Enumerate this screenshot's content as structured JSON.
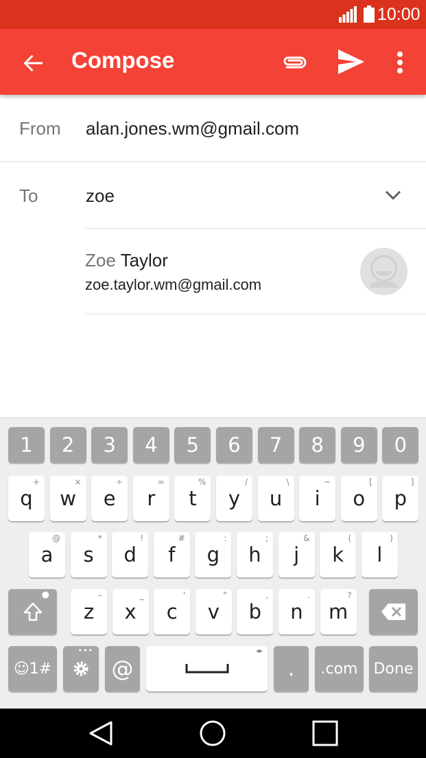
{
  "status_bar": {
    "time": "10:00"
  },
  "app_bar": {
    "title": "Compose"
  },
  "compose": {
    "from_label": "From",
    "from_value": "alan.jones.wm@gmail.com",
    "to_label": "To",
    "to_value": "zoe"
  },
  "suggestion": {
    "first_name": "Zoe",
    "last_name": " Taylor",
    "email": "zoe.taylor.wm@gmail.com"
  },
  "keyboard": {
    "row_numbers": [
      "1",
      "2",
      "3",
      "4",
      "5",
      "6",
      "7",
      "8",
      "9",
      "0"
    ],
    "row1": [
      {
        "k": "q",
        "s": "+"
      },
      {
        "k": "w",
        "s": "×"
      },
      {
        "k": "e",
        "s": "÷"
      },
      {
        "k": "r",
        "s": "="
      },
      {
        "k": "t",
        "s": "%"
      },
      {
        "k": "y",
        "s": "/"
      },
      {
        "k": "u",
        "s": "\\"
      },
      {
        "k": "i",
        "s": "~"
      },
      {
        "k": "o",
        "s": "["
      },
      {
        "k": "p",
        "s": "]"
      }
    ],
    "row2": [
      {
        "k": "a",
        "s": "@"
      },
      {
        "k": "s",
        "s": "*"
      },
      {
        "k": "d",
        "s": "!"
      },
      {
        "k": "f",
        "s": "#"
      },
      {
        "k": "g",
        "s": ":"
      },
      {
        "k": "h",
        "s": ";"
      },
      {
        "k": "j",
        "s": "&"
      },
      {
        "k": "k",
        "s": "("
      },
      {
        "k": "l",
        "s": ")"
      }
    ],
    "row3": [
      {
        "k": "z",
        "s": "–"
      },
      {
        "k": "x",
        "s": "_"
      },
      {
        "k": "c",
        "s": "'"
      },
      {
        "k": "v",
        "s": "\""
      },
      {
        "k": "b",
        "s": ","
      },
      {
        "k": "n",
        "s": "."
      },
      {
        "k": "m",
        "s": "?"
      }
    ],
    "emoji_label": "☺1#",
    "at_label": "@",
    "period_label": ".",
    "dotcom_label": ".com",
    "done_label": "Done"
  }
}
